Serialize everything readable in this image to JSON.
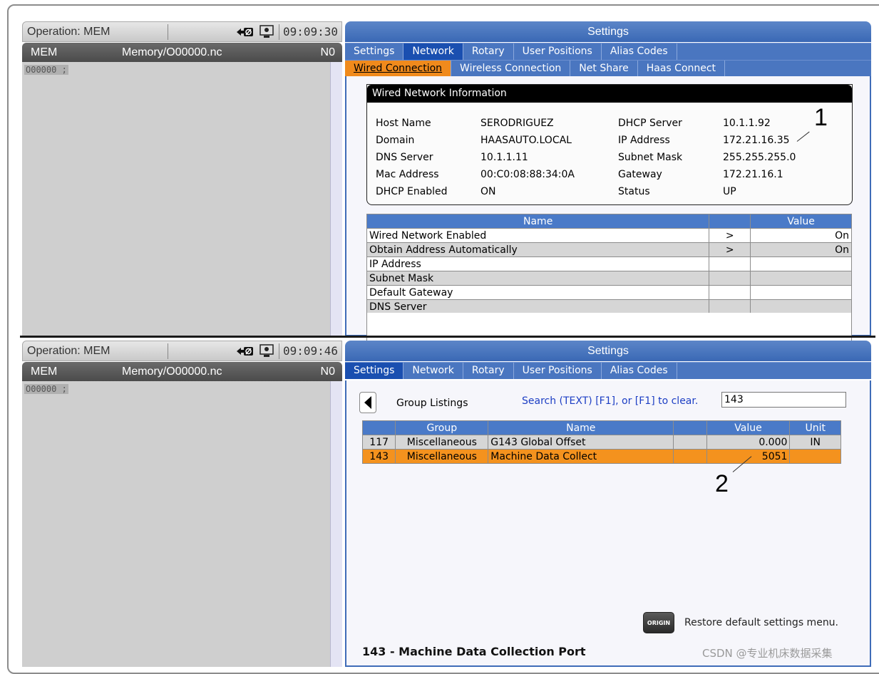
{
  "top": {
    "operation": "Operation: MEM",
    "time": "09:09:30",
    "mem": "MEM",
    "path": "Memory/O00000.nc",
    "n": "N0",
    "prog_line": "O00000 ;",
    "settings_title": "Settings",
    "tabs": [
      "Settings",
      "Network",
      "Rotary",
      "User Positions",
      "Alias Codes"
    ],
    "subtabs": [
      "Wired Connection",
      "Wireless Connection",
      "Net Share",
      "Haas Connect"
    ],
    "info_title": "Wired Network Information",
    "info_left": [
      {
        "label": "Host Name",
        "value": "SERODRIGUEZ"
      },
      {
        "label": "Domain",
        "value": "HAASAUTO.LOCAL"
      },
      {
        "label": "DNS Server",
        "value": "10.1.1.11"
      },
      {
        "label": "Mac Address",
        "value": "00:C0:08:88:34:0A"
      },
      {
        "label": "DHCP Enabled",
        "value": "ON"
      }
    ],
    "info_right": [
      {
        "label": "DHCP Server",
        "value": "10.1.1.92"
      },
      {
        "label": "IP Address",
        "value": "172.21.16.35"
      },
      {
        "label": "Subnet Mask",
        "value": "255.255.255.0"
      },
      {
        "label": "Gateway",
        "value": "172.21.16.1"
      },
      {
        "label": "Status",
        "value": "UP"
      }
    ],
    "table_headers": {
      "name": "Name",
      "value": "Value"
    },
    "rows": [
      {
        "name": "Wired Network Enabled",
        "arrow": ">",
        "value": "On"
      },
      {
        "name": "Obtain Address Automatically",
        "arrow": ">",
        "value": "On"
      },
      {
        "name": "IP Address",
        "arrow": "",
        "value": ""
      },
      {
        "name": "Subnet Mask",
        "arrow": "",
        "value": ""
      },
      {
        "name": "Default Gateway",
        "arrow": "",
        "value": ""
      },
      {
        "name": "DNS Server",
        "arrow": "",
        "value": ""
      }
    ]
  },
  "bottom": {
    "operation": "Operation: MEM",
    "time": "09:09:46",
    "mem": "MEM",
    "path": "Memory/O00000.nc",
    "n": "N0",
    "prog_line": "O00000 ;",
    "settings_title": "Settings",
    "tabs": [
      "Settings",
      "Network",
      "Rotary",
      "User Positions",
      "Alias Codes"
    ],
    "group_listings": "Group Listings",
    "search_hint": "Search (TEXT) [F1], or [F1] to clear.",
    "search_value": "143",
    "table_headers": {
      "group": "Group",
      "name": "Name",
      "value": "Value",
      "unit": "Unit"
    },
    "rows": [
      {
        "num": "117",
        "group": "Miscellaneous",
        "name": "G143 Global Offset",
        "value": "0.000",
        "unit": "IN"
      },
      {
        "num": "143",
        "group": "Miscellaneous",
        "name": "Machine Data Collect",
        "value": "5051",
        "unit": ""
      }
    ],
    "origin_label": "ORIGIN",
    "restore_text": "Restore default settings menu.",
    "setting_desc": "143 - Machine Data Collection Port"
  },
  "callouts": {
    "one": "1",
    "two": "2"
  },
  "watermark": "CSDN @专业机床数据采集",
  "colors": {
    "accent_blue": "#3f6cb8",
    "active_tab": "#1a4fb0",
    "orange": "#f4921e",
    "hint_blue": "#1c3ec4"
  }
}
